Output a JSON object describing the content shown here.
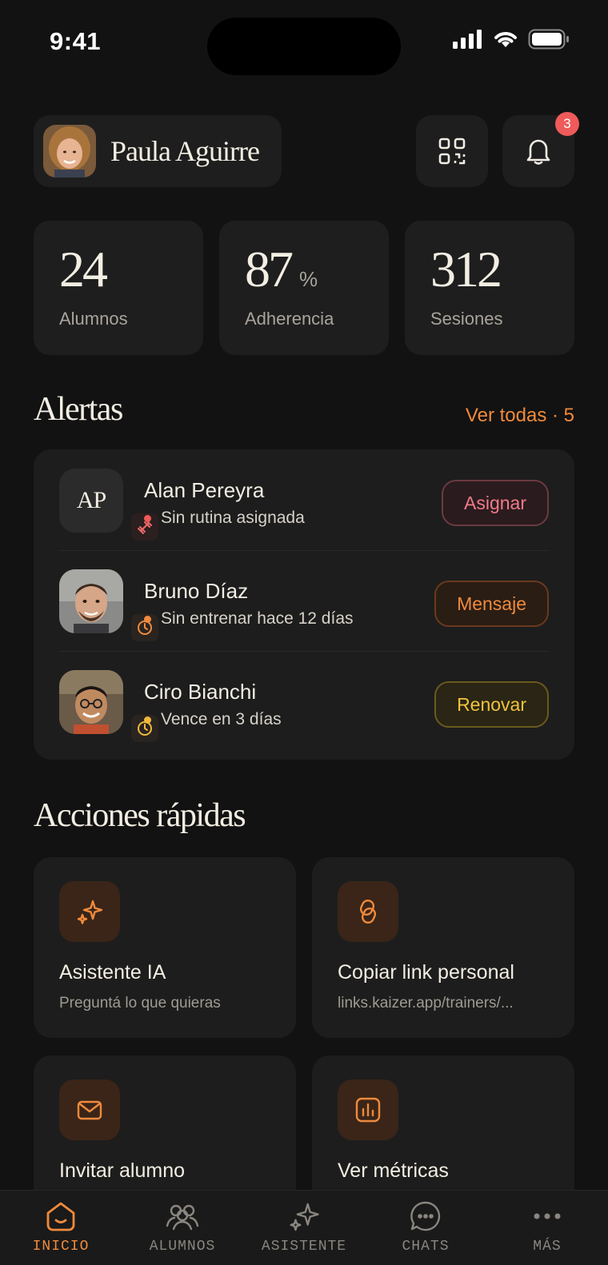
{
  "status_bar": {
    "time": "9:41"
  },
  "header": {
    "user_name": "Paula Aguirre",
    "notification_count": "3",
    "qr_icon": "qr-code-icon",
    "bell_icon": "bell-icon"
  },
  "stats": [
    {
      "value": "24",
      "unit": "",
      "label": "Alumnos"
    },
    {
      "value": "87",
      "unit": "%",
      "label": "Adherencia"
    },
    {
      "value": "312",
      "unit": "",
      "label": "Sesiones"
    }
  ],
  "alerts": {
    "title": "Alertas",
    "see_all": "Ver todas · 5",
    "items": [
      {
        "initials": "AP",
        "name": "Alan Pereyra",
        "status": "Sin rutina asignada",
        "status_color": "#ef5a5a",
        "badge_icon": "dumbbell-icon",
        "action": "Asignar",
        "action_color": "#f07a8a"
      },
      {
        "initials": "",
        "name": "Bruno Díaz",
        "status": "Sin entrenar hace 12 días",
        "status_color": "#f08a3c",
        "badge_icon": "clock-icon",
        "action": "Mensaje",
        "action_color": "#f08a3c"
      },
      {
        "initials": "",
        "name": "Ciro Bianchi",
        "status": "Vence en 3 días",
        "status_color": "#f0b93c",
        "badge_icon": "clock-icon",
        "action": "Renovar",
        "action_color": "#f0c23c"
      }
    ]
  },
  "quick_actions": {
    "title": "Acciones rápidas",
    "items": [
      {
        "icon": "sparkles-icon",
        "title": "Asistente IA",
        "subtitle": "Preguntá lo que quieras"
      },
      {
        "icon": "link-icon",
        "title": "Copiar link personal",
        "subtitle": "links.kaizer.app/trainers/..."
      },
      {
        "icon": "mail-icon",
        "title": "Invitar alumno",
        "subtitle": ""
      },
      {
        "icon": "bar-chart-icon",
        "title": "Ver métricas",
        "subtitle": ""
      }
    ]
  },
  "tab_bar": {
    "active_color": "#f08a3c",
    "tabs": [
      {
        "label": "INICIO",
        "icon": "home-icon",
        "active": true
      },
      {
        "label": "ALUMNOS",
        "icon": "users-icon",
        "active": false
      },
      {
        "label": "ASISTENTE",
        "icon": "sparkles-icon",
        "active": false
      },
      {
        "label": "CHATS",
        "icon": "chat-bubble-icon",
        "active": false
      },
      {
        "label": "MÁS",
        "icon": "more-dots-icon",
        "active": false
      }
    ]
  }
}
